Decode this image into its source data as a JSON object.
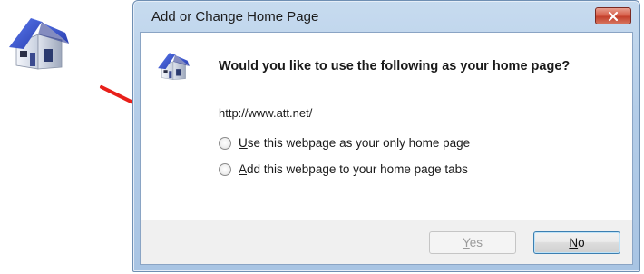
{
  "dialog": {
    "title": "Add or Change Home Page",
    "question": "Would you like to use the following as your home page?",
    "url": "http://www.att.net/",
    "options": [
      {
        "prefix": "",
        "mnemonic": "U",
        "rest": "se this webpage as your only home page",
        "selected": false
      },
      {
        "prefix": "",
        "mnemonic": "A",
        "rest": "dd this webpage to your home page tabs",
        "selected": false
      }
    ],
    "buttons": {
      "yes": {
        "mnemonic": "Y",
        "rest": "es",
        "enabled": false
      },
      "no": {
        "mnemonic": "N",
        "rest": "o",
        "enabled": true,
        "default": true
      }
    }
  },
  "icons": {
    "standalone": "home-icon",
    "dialog": "home-icon",
    "close": "close-icon",
    "annotation": "red-arrow"
  },
  "colors": {
    "arrow": "#e8201a",
    "close_button": "#c9452f",
    "roof": "#3c5ad1"
  }
}
